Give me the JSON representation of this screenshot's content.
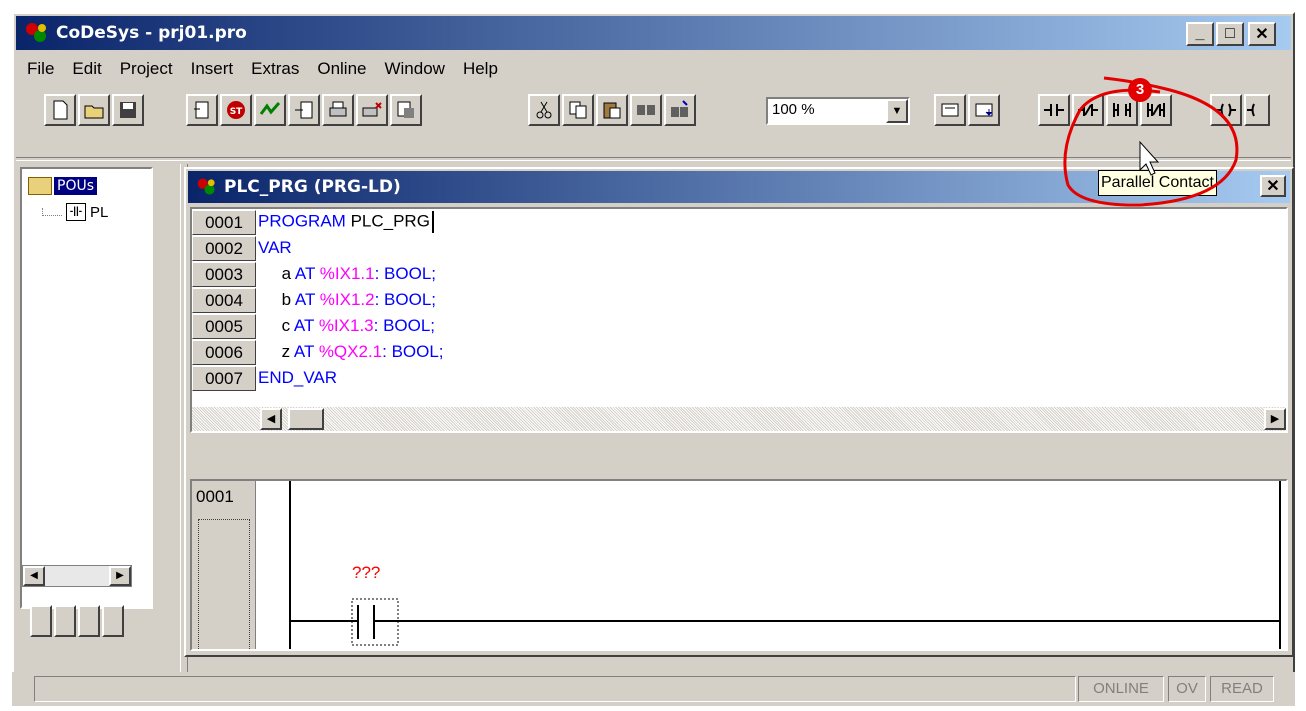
{
  "window": {
    "title": "CoDeSys - prj01.pro"
  },
  "menu": [
    "File",
    "Edit",
    "Project",
    "Insert",
    "Extras",
    "Online",
    "Window",
    "Help"
  ],
  "toolbar": {
    "zoom_value": "100 %",
    "contact_labels": [
      "-| |-",
      "-|/|-",
      "-||-",
      "-|/|-"
    ]
  },
  "tree": {
    "root_label": "POUs",
    "child_label": "PL"
  },
  "editor": {
    "title": "PLC_PRG (PRG-LD)",
    "lines": [
      {
        "num": "0001",
        "kw": "PROGRAM",
        "rest": " PLC_PRG"
      },
      {
        "num": "0002",
        "kw": "VAR",
        "rest": ""
      },
      {
        "num": "0003",
        "name": "a",
        "at": "AT",
        "addr": "%IX1.1",
        "type": ": BOOL;"
      },
      {
        "num": "0004",
        "name": "b",
        "at": "AT",
        "addr": "%IX1.2",
        "type": ": BOOL;"
      },
      {
        "num": "0005",
        "name": "c",
        "at": "AT",
        "addr": "%IX1.3",
        "type": ": BOOL;"
      },
      {
        "num": "0006",
        "name": "z",
        "at": "AT",
        "addr": "%QX2.1",
        "type": ": BOOL;"
      },
      {
        "num": "0007",
        "kw": "END_VAR",
        "rest": ""
      }
    ],
    "network_number": "0001",
    "contact_label": "???"
  },
  "tooltip": "Parallel Contact",
  "annotation_badge": "3",
  "status": {
    "online": "ONLINE",
    "ov": "OV",
    "read": "READ"
  },
  "colors": {
    "keyword": "#0000ff",
    "address": "#ff00ff",
    "annotation": "#e20000",
    "title_start": "#0a246a",
    "title_end": "#a6caf0"
  }
}
